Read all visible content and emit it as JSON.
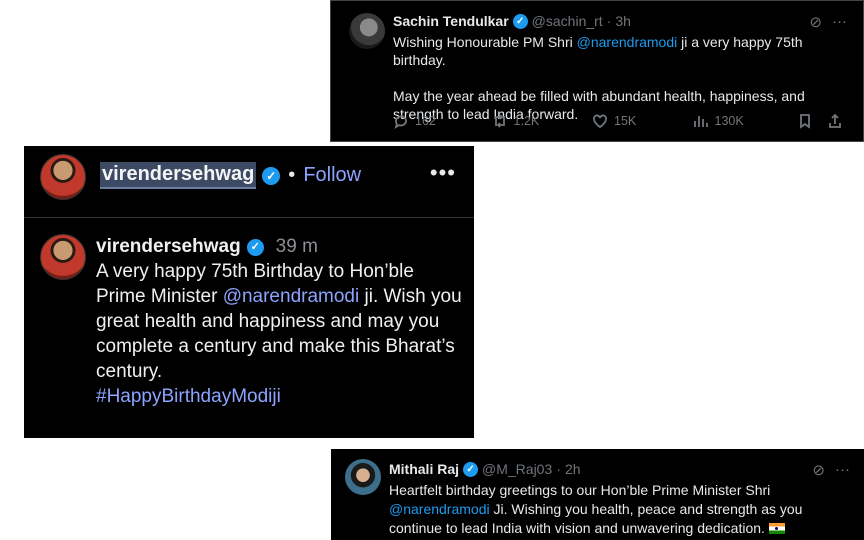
{
  "sachin": {
    "name": "Sachin Tendulkar",
    "handle": "@sachin_rt",
    "time": "3h",
    "line1_pre": "Wishing Honourable PM Shri ",
    "line1_mention": "@narendramodi",
    "line1_post": " ji a very happy 75th birthday.",
    "line2": "May the year ahead be filled with abundant health, happiness, and strength to lead India forward.",
    "replies": "162",
    "reposts": "1.2K",
    "likes": "15K",
    "views": "130K"
  },
  "sehwag": {
    "username": "virendersehwag",
    "follow": "Follow",
    "dot": "•",
    "more": "•••",
    "time": "39 m",
    "text_pre": "A very happy 75th Birthday to Hon’ble Prime Minister ",
    "mention": "@narendramodi",
    "text_post": " ji. Wish you great health and happiness and may you complete a century and make this Bharat’s century.",
    "hashtag": "#HappyBirthdayModiji"
  },
  "mithali": {
    "name": "Mithali Raj",
    "handle": "@M_Raj03",
    "time": "2h",
    "text_pre": "Heartfelt birthday greetings to our Hon’ble Prime Minister Shri ",
    "mention": "@narendramodi",
    "text_post": " Ji. Wishing you health, peace and strength as you continue to lead India with vision and unwavering dedication. "
  },
  "icons": {
    "verified": "✓",
    "grok": "⊘",
    "more": "···",
    "separator": "·",
    "flag": "india-flag-emoji"
  }
}
